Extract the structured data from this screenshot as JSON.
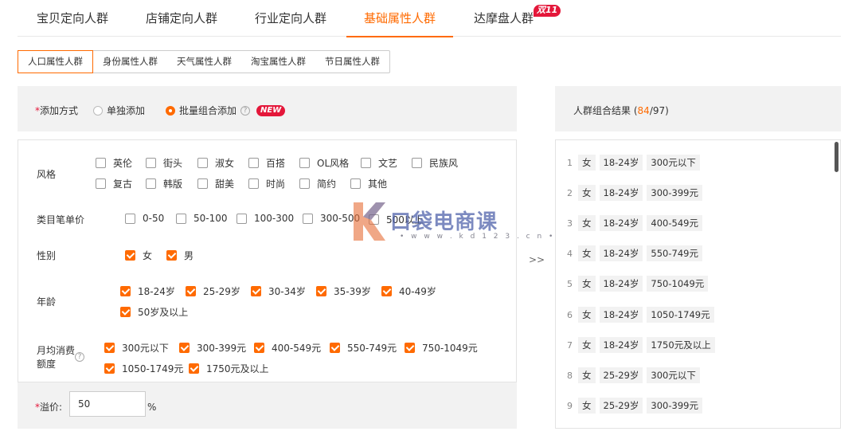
{
  "top_tabs": [
    {
      "label": "宝贝定向人群"
    },
    {
      "label": "店铺定向人群"
    },
    {
      "label": "行业定向人群"
    },
    {
      "label": "基础属性人群"
    },
    {
      "label": "达摩盘人群"
    }
  ],
  "active_top_tab": "基础属性人群",
  "hot_badge": "双11",
  "sub_tabs": [
    {
      "label": "人口属性人群"
    },
    {
      "label": "身份属性人群"
    },
    {
      "label": "天气属性人群"
    },
    {
      "label": "淘宝属性人群"
    },
    {
      "label": "节日属性人群"
    }
  ],
  "method": {
    "required_mark": "*",
    "label": "添加方式",
    "option_single": "单独添加",
    "option_batch": "批量组合添加",
    "selected": "批量组合添加",
    "help": "?",
    "new_badge": "NEW"
  },
  "attributes": {
    "style": {
      "label": "风格",
      "options": [
        {
          "label": "英伦",
          "checked": false
        },
        {
          "label": "街头",
          "checked": false
        },
        {
          "label": "淑女",
          "checked": false
        },
        {
          "label": "百搭",
          "checked": false
        },
        {
          "label": "OL风格",
          "checked": false
        },
        {
          "label": "文艺",
          "checked": false
        },
        {
          "label": "民族风",
          "checked": false
        },
        {
          "label": "复古",
          "checked": false
        },
        {
          "label": "韩版",
          "checked": false
        },
        {
          "label": "甜美",
          "checked": false
        },
        {
          "label": "时尚",
          "checked": false
        },
        {
          "label": "简约",
          "checked": false
        },
        {
          "label": "其他",
          "checked": false
        }
      ]
    },
    "price": {
      "label": "类目笔单价",
      "options": [
        {
          "label": "0-50",
          "checked": false
        },
        {
          "label": "50-100",
          "checked": false
        },
        {
          "label": "100-300",
          "checked": false
        },
        {
          "label": "300-500",
          "checked": false
        },
        {
          "label": "500以上",
          "checked": false
        }
      ]
    },
    "gender": {
      "label": "性别",
      "options": [
        {
          "label": "女",
          "checked": true
        },
        {
          "label": "男",
          "checked": true
        }
      ]
    },
    "age": {
      "label": "年龄",
      "options": [
        {
          "label": "18-24岁",
          "checked": true
        },
        {
          "label": "25-29岁",
          "checked": true
        },
        {
          "label": "30-34岁",
          "checked": true
        },
        {
          "label": "35-39岁",
          "checked": true
        },
        {
          "label": "40-49岁",
          "checked": true
        },
        {
          "label": "50岁及以上",
          "checked": true
        }
      ]
    },
    "spend": {
      "label_line1": "月均消费",
      "label_line2": "额度",
      "help": "?",
      "options": [
        {
          "label": "300元以下",
          "checked": true
        },
        {
          "label": "300-399元",
          "checked": true
        },
        {
          "label": "400-549元",
          "checked": true
        },
        {
          "label": "550-749元",
          "checked": true
        },
        {
          "label": "750-1049元",
          "checked": true
        },
        {
          "label": "1050-1749元",
          "checked": true
        },
        {
          "label": "1750元及以上",
          "checked": true
        }
      ]
    }
  },
  "premium": {
    "required_mark": "*",
    "label": "溢价:",
    "value": "50",
    "unit": "%"
  },
  "arrow": ">>",
  "result": {
    "title": "人群组合结果",
    "open": "(",
    "count": "84",
    "sep": "/",
    "total": "97",
    "close": ")",
    "rows": [
      {
        "num": "1",
        "gender": "女",
        "age": "18-24岁",
        "spend": "300元以下"
      },
      {
        "num": "2",
        "gender": "女",
        "age": "18-24岁",
        "spend": "300-399元"
      },
      {
        "num": "3",
        "gender": "女",
        "age": "18-24岁",
        "spend": "400-549元"
      },
      {
        "num": "4",
        "gender": "女",
        "age": "18-24岁",
        "spend": "550-749元"
      },
      {
        "num": "5",
        "gender": "女",
        "age": "18-24岁",
        "spend": "750-1049元"
      },
      {
        "num": "6",
        "gender": "女",
        "age": "18-24岁",
        "spend": "1050-1749元"
      },
      {
        "num": "7",
        "gender": "女",
        "age": "18-24岁",
        "spend": "1750元及以上"
      },
      {
        "num": "8",
        "gender": "女",
        "age": "25-29岁",
        "spend": "300元以下"
      },
      {
        "num": "9",
        "gender": "女",
        "age": "25-29岁",
        "spend": "300-399元"
      }
    ]
  },
  "watermark": {
    "text": "口袋电商课",
    "url": "• w w w . k d 1 2 3 . c n •",
    "brand_color": "#e8703a",
    "text_color": "#4a5ea8"
  },
  "colors": {
    "accent": "#ff6a00",
    "badge_red": "#e4173a",
    "panel_gray": "#f2f2f2"
  }
}
